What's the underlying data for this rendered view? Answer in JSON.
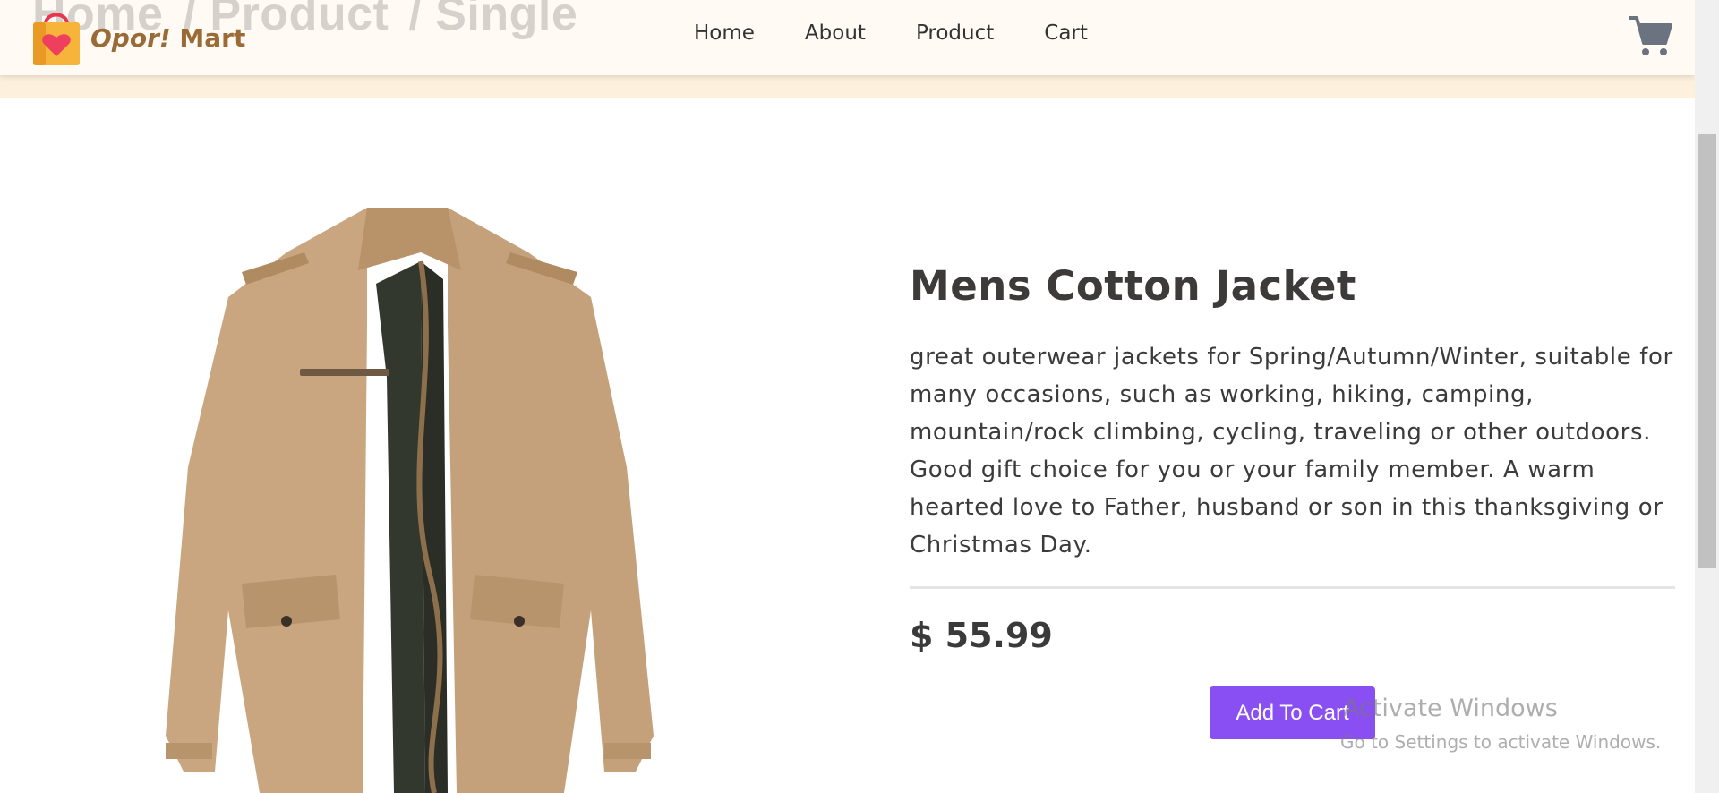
{
  "breadcrumb": [
    "Home",
    "/ Product",
    "/ Single"
  ],
  "brand": {
    "part1": "Opor!",
    "part2": "Mart"
  },
  "nav": [
    "Home",
    "About",
    "Product",
    "Cart"
  ],
  "icons": {
    "logo": "shopping-bag-heart-icon",
    "cart": "cart-icon"
  },
  "product": {
    "title": "Mens Cotton Jacket",
    "description": "great outerwear jackets for Spring/Autumn/Winter, suitable for many occasions, such as working, hiking, camping, mountain/rock climbing, cycling, traveling or other outdoors. Good gift choice for you or your family member. A warm hearted love to Father, husband or son in this thanksgiving or Christmas Day.",
    "price": "$ 55.99",
    "add_to_cart_label": "Add To Cart"
  },
  "watermark": {
    "title": "Activate Windows",
    "subtitle": "Go to Settings to activate Windows."
  },
  "colors": {
    "accent": "#8a4ff2",
    "header_bg": "#fffaf3",
    "brand": "#9a6b36"
  }
}
